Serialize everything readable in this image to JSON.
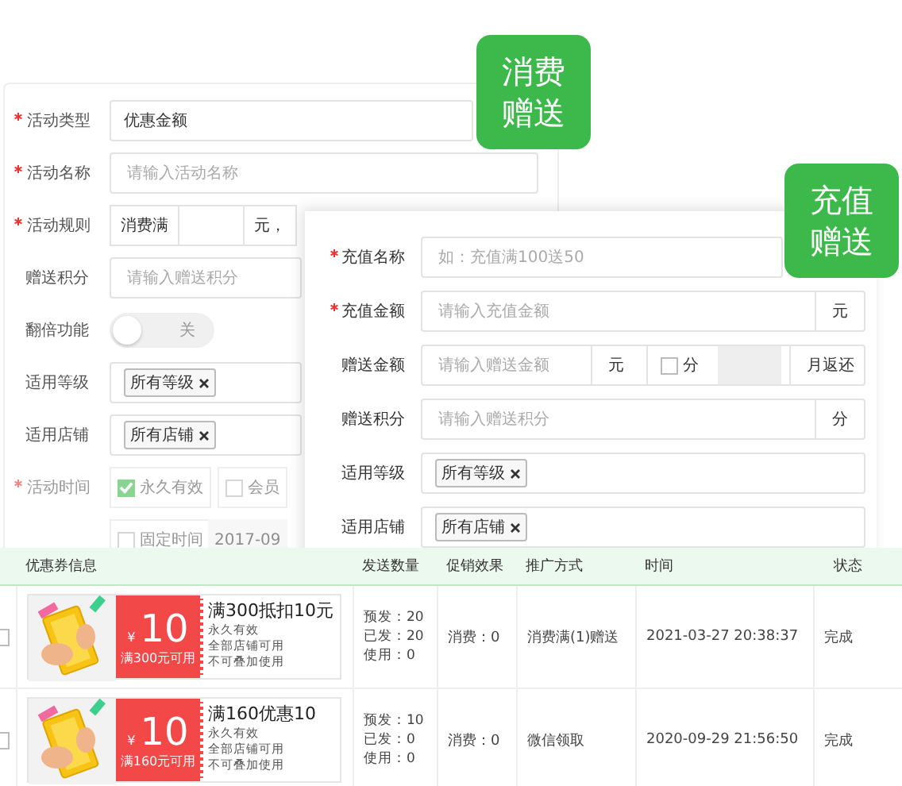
{
  "consumption_badge": {
    "lines": [
      "消费",
      "赠送"
    ]
  },
  "consumption_form": {
    "fields": [
      {
        "kind": "select",
        "label": "活动类型",
        "required": true,
        "value": "优惠金额"
      },
      {
        "kind": "input",
        "label": "活动名称",
        "required": true,
        "placeholder": "请输入活动名称"
      },
      {
        "kind": "rule",
        "label": "活动规则",
        "required": true,
        "parts": [
          "消费满",
          "元，"
        ]
      },
      {
        "kind": "input",
        "label": "赠送积分",
        "required": false,
        "placeholder": "请输入赠送积分"
      },
      {
        "kind": "toggle",
        "label": "翻倍功能",
        "required": false,
        "on": false,
        "text": "关"
      },
      {
        "kind": "tags",
        "label": "适用等级",
        "required": false,
        "tags": [
          "所有等级"
        ]
      },
      {
        "kind": "tags",
        "label": "适用店铺",
        "required": false,
        "tags": [
          "所有店铺"
        ]
      },
      {
        "kind": "checks",
        "label": "活动时间",
        "required": true,
        "disabled": true,
        "options": [
          {
            "label": "永久有效",
            "checked": true
          },
          {
            "label": "会员",
            "checked": false
          }
        ]
      },
      {
        "kind": "date",
        "disabled": true,
        "option": {
          "label": "固定时间",
          "checked": false
        },
        "value": "2017-09"
      }
    ]
  },
  "recharge_badge": {
    "lines": [
      "充值",
      "赠送"
    ]
  },
  "recharge_form": {
    "fields": [
      {
        "kind": "input",
        "label": "充值名称",
        "required": true,
        "placeholder": "如：充值满100送50"
      },
      {
        "kind": "input",
        "label": "充值金额",
        "required": true,
        "placeholder": "请输入充值金额",
        "suffix": "元"
      },
      {
        "kind": "split",
        "label": "赠送金额",
        "required": false,
        "placeholder": "请输入赠送金额",
        "unit": "元",
        "option": {
          "label": "分",
          "checked": false
        },
        "tail": "月返还"
      },
      {
        "kind": "input",
        "label": "赠送积分",
        "required": false,
        "placeholder": "请输入赠送积分",
        "suffix": "分"
      },
      {
        "kind": "tags",
        "label": "适用等级",
        "required": false,
        "tags": [
          "所有等级"
        ]
      },
      {
        "kind": "tags",
        "label": "适用店铺",
        "required": false,
        "tags": [
          "所有店铺"
        ]
      }
    ]
  },
  "table": {
    "columns": [
      "优惠券信息",
      "发送数量",
      "促销效果",
      "推广方式",
      "时间",
      "状态"
    ],
    "rows": [
      {
        "checked": false,
        "coupon": {
          "currency": "¥",
          "amount": "10",
          "condition": "满300元可用",
          "title": "满300抵扣10元",
          "lines": [
            "永久有效",
            "全部店铺可用",
            "不可叠加使用"
          ]
        },
        "sent": [
          "预发：20",
          "已发：20",
          "使用：0"
        ],
        "effect": "消费：0",
        "promotion": "消费满(1)赠送",
        "time": "2021-03-27 20:38:37",
        "status": "完成"
      },
      {
        "checked": false,
        "coupon": {
          "currency": "¥",
          "amount": "10",
          "condition": "满160元可用",
          "title": "满160优惠10",
          "lines": [
            "永久有效",
            "全部店铺可用",
            "不可叠加使用"
          ]
        },
        "sent": [
          "预发：10",
          "已发：0",
          "使用：0"
        ],
        "effect": "消费：0",
        "promotion": "微信领取",
        "time": "2020-09-29 21:56:50",
        "status": "完成"
      }
    ]
  }
}
